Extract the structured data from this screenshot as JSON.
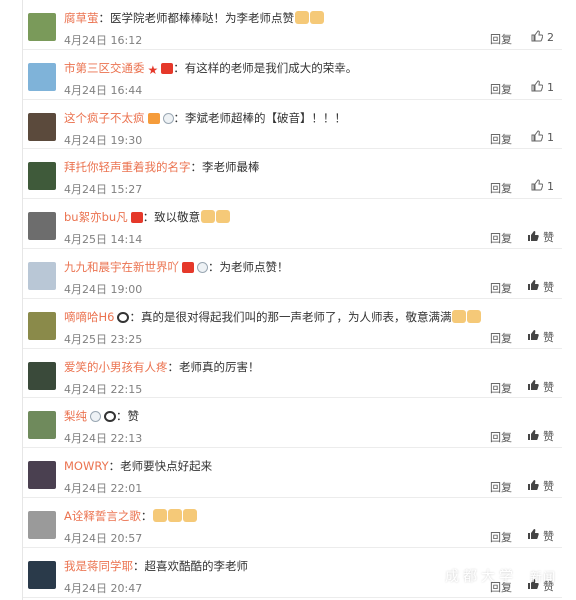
{
  "comments": [
    {
      "name": "腐草萤",
      "text": "：医学院老师都棒棒哒！为李老师点赞",
      "emoji": "thumbs-up",
      "emoji_count": 2,
      "time": "4月24日 16:12",
      "reply": "回复",
      "likes": "2",
      "avatar_color": "#7a9a5a",
      "badges": []
    },
    {
      "name": "市第三区交通委",
      "text": "：有这样的老师是我们成大的荣幸。",
      "emoji": "",
      "emoji_count": 0,
      "time": "4月24日 16:44",
      "reply": "回复",
      "likes": "1",
      "avatar_color": "#7fb3d9",
      "badges": [
        "star",
        "red"
      ]
    },
    {
      "name": "这个疯子不太疯",
      "text": "：李斌老师超棒的【破音】！！！",
      "emoji": "",
      "emoji_count": 0,
      "time": "4月24日 19:30",
      "reply": "回复",
      "likes": "1",
      "avatar_color": "#5b4a3c",
      "badges": [
        "orange",
        "medal"
      ]
    },
    {
      "name": "拜托你轻声重着我的名字",
      "text": "：李老师最棒",
      "emoji": "",
      "emoji_count": 0,
      "time": "4月24日 15:27",
      "reply": "回复",
      "likes": "1",
      "avatar_color": "#3f5a3a",
      "badges": []
    },
    {
      "name": "bu絮亦bu凡",
      "text": "：致以敬意",
      "emoji": "thumbs-up",
      "emoji_count": 2,
      "time": "4月25日 14:14",
      "reply": "回复",
      "likes": "赞",
      "avatar_color": "#6d6d6d",
      "badges": [
        "red"
      ]
    },
    {
      "name": "九九和晨宇在新世界吖",
      "text": "：为老师点赞！",
      "emoji": "",
      "emoji_count": 0,
      "time": "4月24日 19:00",
      "reply": "回复",
      "likes": "赞",
      "avatar_color": "#b9c7d6",
      "badges": [
        "red",
        "medal"
      ]
    },
    {
      "name": "嘀嘀哈H6",
      "text": "：真的是很对得起我们叫的那一声老师了，为人师表，敬意满满",
      "emoji": "clap",
      "emoji_count": 2,
      "time": "4月25日 23:25",
      "reply": "回复",
      "likes": "赞",
      "avatar_color": "#8a8a4a",
      "badges": [
        "panda"
      ]
    },
    {
      "name": "爱笑的小男孩有人疼",
      "text": "：老师真的厉害！",
      "emoji": "",
      "emoji_count": 0,
      "time": "4月24日 22:15",
      "reply": "回复",
      "likes": "赞",
      "avatar_color": "#3a4a3a",
      "badges": []
    },
    {
      "name": "梨纯",
      "text": "：赞",
      "emoji": "",
      "emoji_count": 0,
      "time": "4月24日 22:13",
      "reply": "回复",
      "likes": "赞",
      "avatar_color": "#6f8a5c",
      "badges": [
        "medal",
        "panda"
      ]
    },
    {
      "name": "MOWRY",
      "text": "：老师要快点好起来",
      "emoji": "",
      "emoji_count": 0,
      "time": "4月24日 22:01",
      "reply": "回复",
      "likes": "赞",
      "avatar_color": "#4a4050",
      "badges": []
    },
    {
      "name": "A诠释誓言之歌",
      "text": "：",
      "emoji": "thumbs-up",
      "emoji_count": 3,
      "time": "4月24日 20:57",
      "reply": "回复",
      "likes": "赞",
      "avatar_color": "#9a9a9a",
      "badges": []
    },
    {
      "name": "我是蒋同学耶",
      "text": "：超喜欢酷酷的李老师",
      "emoji": "",
      "emoji_count": 0,
      "time": "4月24日 20:47",
      "reply": "回复",
      "likes": "赞",
      "avatar_color": "#2a3a4a",
      "badges": []
    }
  ],
  "watermark": {
    "title": "成都大学",
    "sub": "新闻"
  },
  "colors": {
    "username": "#eb7350",
    "time": "#808080",
    "text": "#333333"
  }
}
